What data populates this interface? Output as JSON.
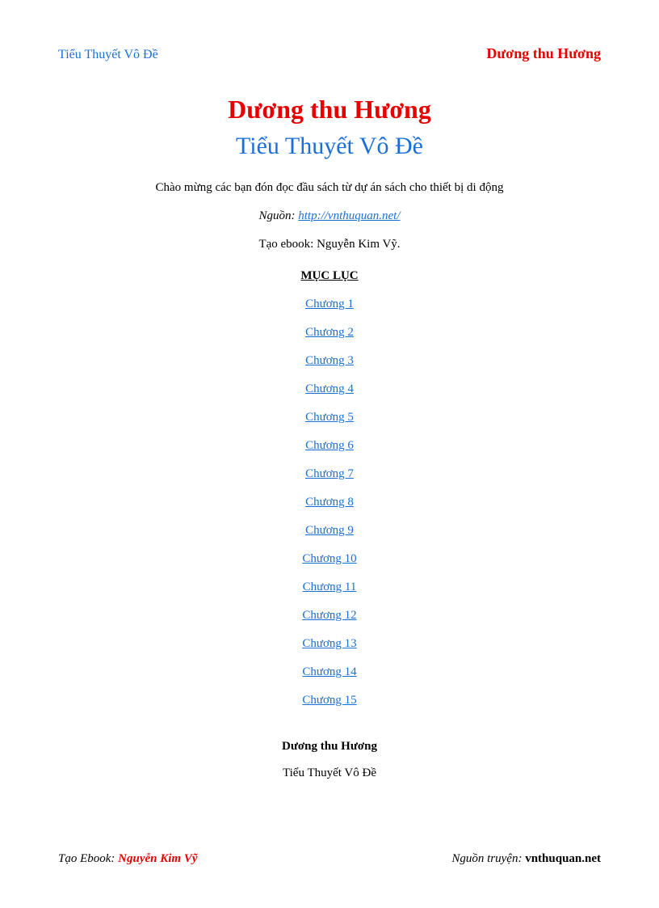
{
  "header": {
    "left": "Tiểu Thuyết Vô Đề",
    "right": "Dương thu Hương"
  },
  "main_title": "Dương thu Hương",
  "sub_title": "Tiểu Thuyết Vô Đề",
  "welcome": "Chào mừng các bạn đón đọc đầu sách từ dự án sách cho thiết bị di động",
  "source": {
    "label": "Nguồn: ",
    "url": "http://vnthuquan.net/"
  },
  "creator": "Tạo ebook: Nguyễn Kim Vỹ.",
  "toc_heading": "MỤC LỤC",
  "toc": [
    "Chương 1",
    "Chương 2",
    "Chương 3",
    "Chương 4",
    "Chương 5",
    "Chương 6",
    "Chương 7",
    "Chương 8",
    "Chương 9",
    "Chương 10",
    "Chương 11",
    "Chương 12",
    "Chương 13",
    "Chương 14",
    "Chương 15"
  ],
  "section": {
    "author": "Dương thu Hương",
    "title": "Tiểu Thuyết Vô Đề"
  },
  "footer": {
    "left_label": "Tạo Ebook",
    "left_value": "Nguyễn Kim Vỹ",
    "right_label": "Nguồn truyện",
    "right_value": "vnthuquan.net"
  }
}
